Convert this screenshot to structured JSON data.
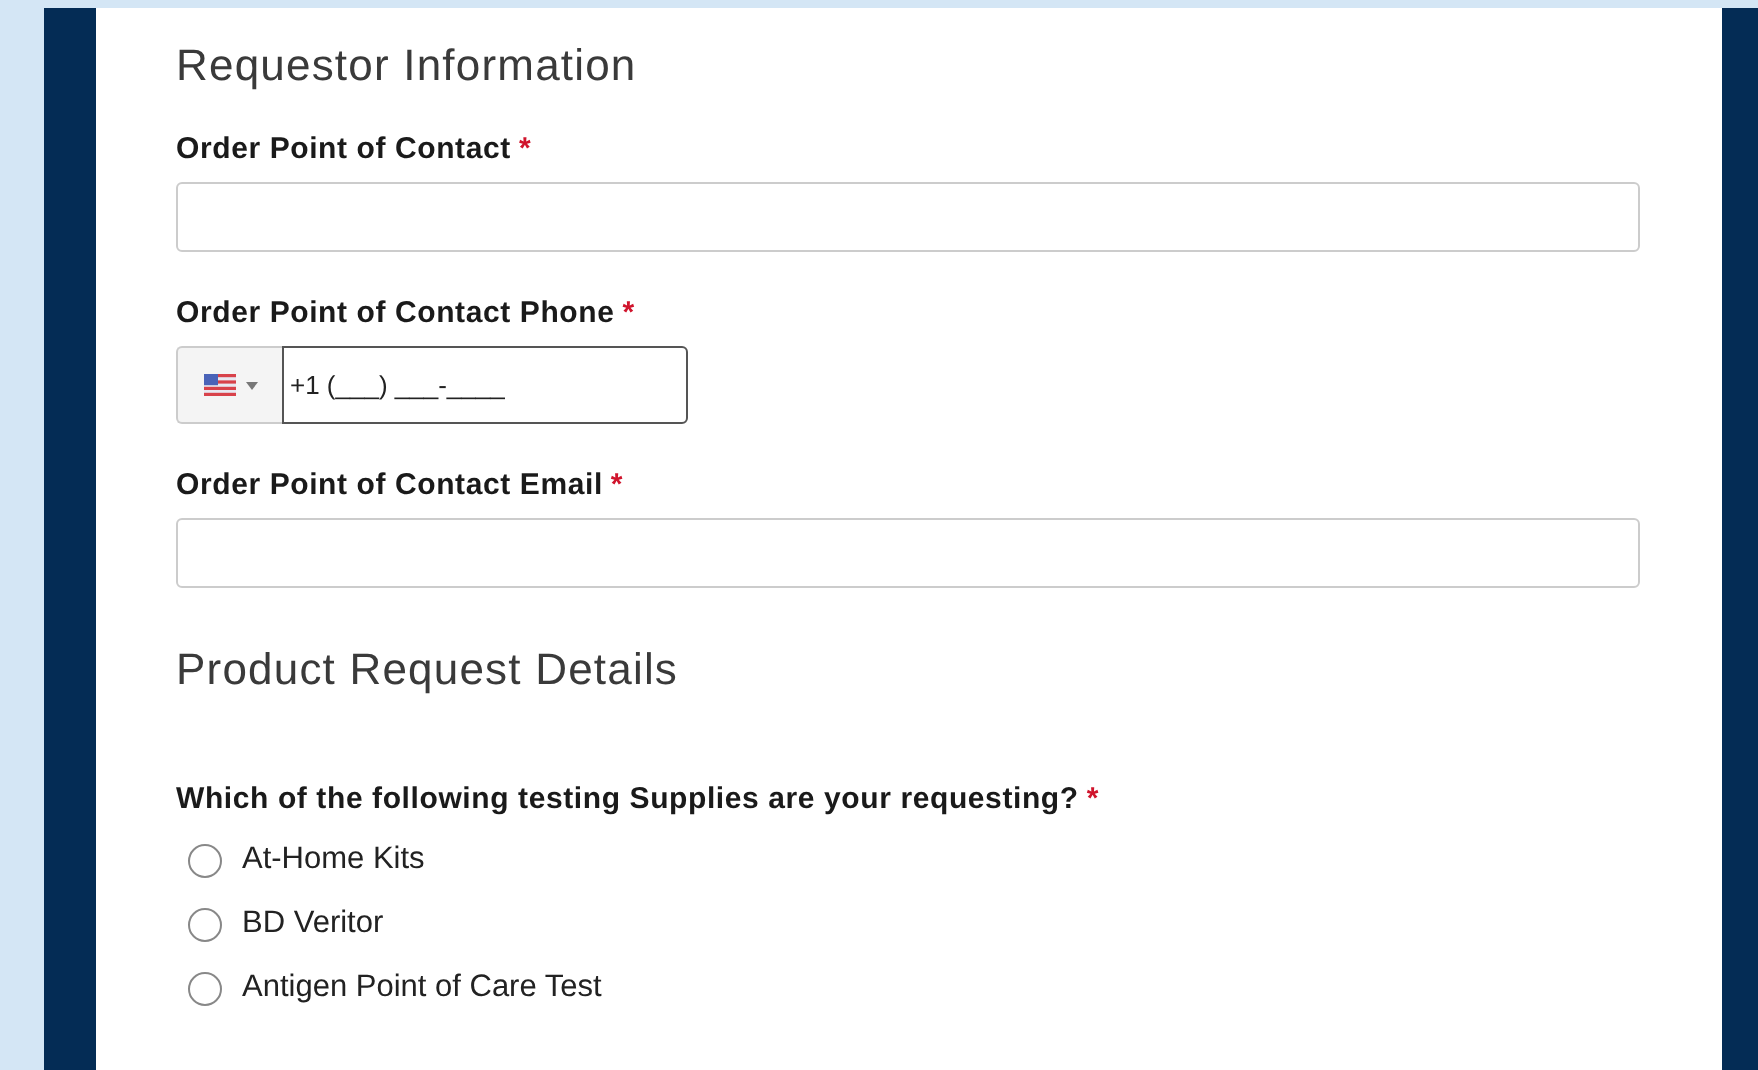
{
  "sections": [
    {
      "kind": "heading",
      "title": "Requestor Information"
    },
    {
      "kind": "text",
      "label": "Order Point of Contact",
      "mark": "*"
    },
    {
      "kind": "phone",
      "label": "Order Point of Contact Phone",
      "mark": "*",
      "value": "+1 (___) ___-____"
    },
    {
      "kind": "text",
      "label": "Order Point of Contact Email",
      "mark": "*"
    },
    {
      "kind": "heading",
      "title": "Product Request Details"
    },
    {
      "kind": "radio",
      "label": "Which of the following testing Supplies are your requesting?",
      "mark": "*",
      "options": [
        {
          "label": "At-Home Kits",
          "selected": false
        },
        {
          "label": "BD Veritor",
          "selected": false
        },
        {
          "label": "Antigen Point of Care Test",
          "selected": false
        }
      ]
    }
  ]
}
